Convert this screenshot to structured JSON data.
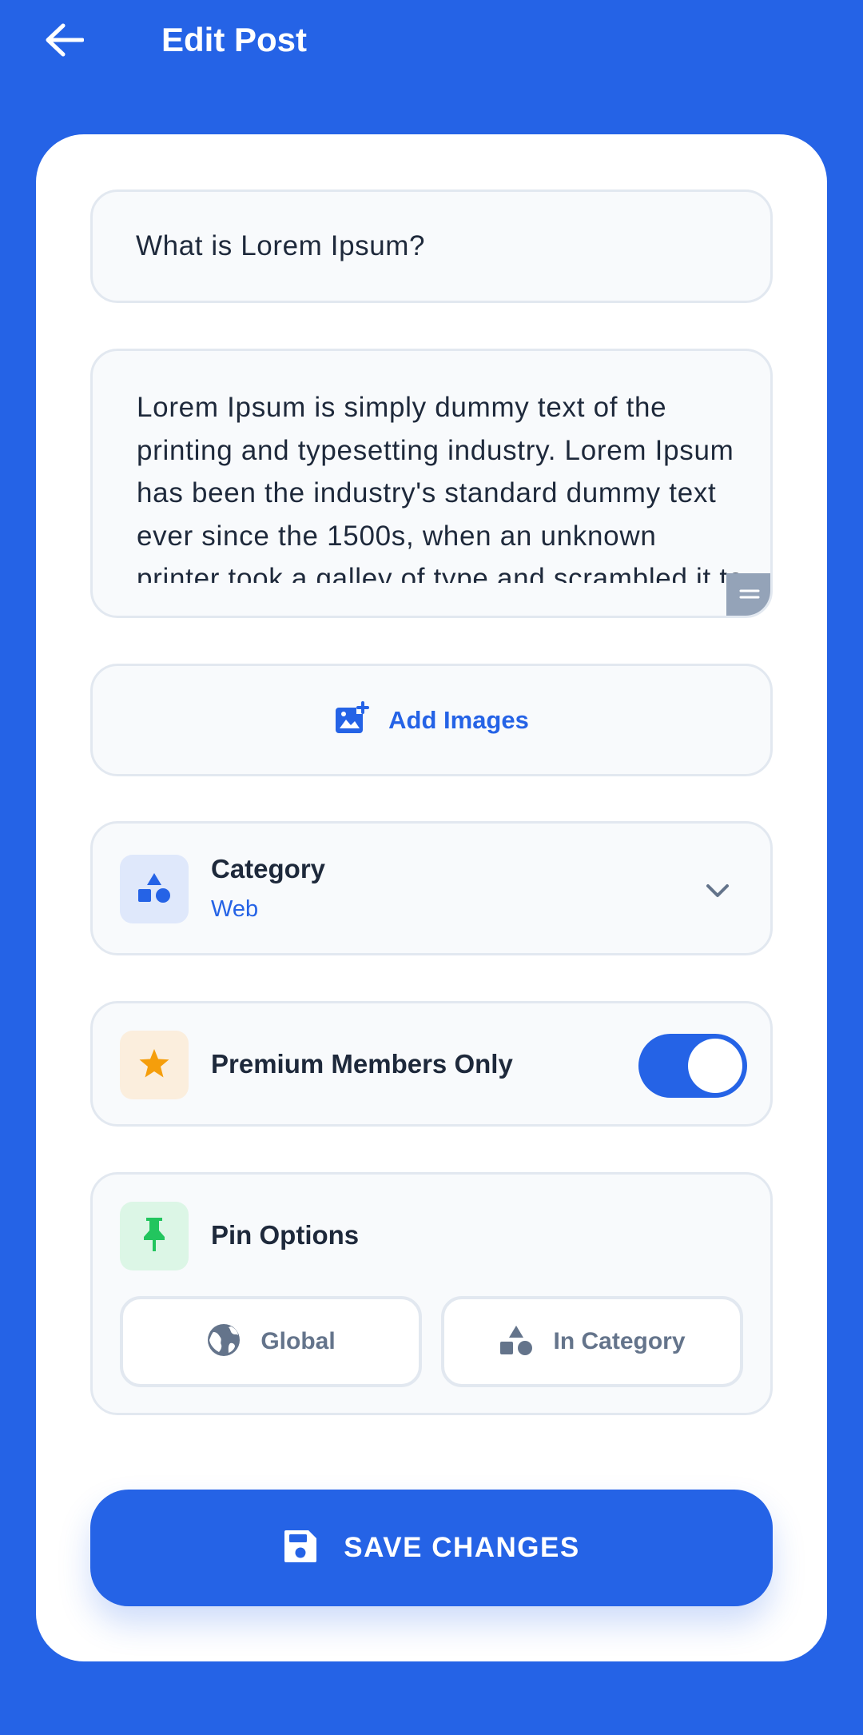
{
  "app_bar": {
    "title": "Edit Post",
    "back_icon": "arrow-left-icon"
  },
  "form": {
    "title_value": "What is Lorem Ipsum?",
    "body_value": "Lorem Ipsum is simply dummy text of the printing and typesetting industry. Lorem Ipsum has been the industry's standard dummy text ever since the 1500s, when an unknown printer took a galley of type and scrambled it to make a type specimen book.",
    "add_images_label": "Add Images",
    "category": {
      "label": "Category",
      "value": "Web",
      "icon": "shapes-icon"
    },
    "premium": {
      "label": "Premium Members Only",
      "enabled": true,
      "icon": "star-icon"
    },
    "pin_options": {
      "label": "Pin Options",
      "icon": "pin-icon",
      "options": [
        {
          "label": "Global",
          "icon": "globe-icon"
        },
        {
          "label": "In Category",
          "icon": "shapes-icon"
        }
      ]
    },
    "save_label": "SAVE CHANGES"
  },
  "colors": {
    "primary": "#2563e6",
    "star": "#f59e0b",
    "pin": "#22c55e",
    "muted": "#64748b"
  }
}
